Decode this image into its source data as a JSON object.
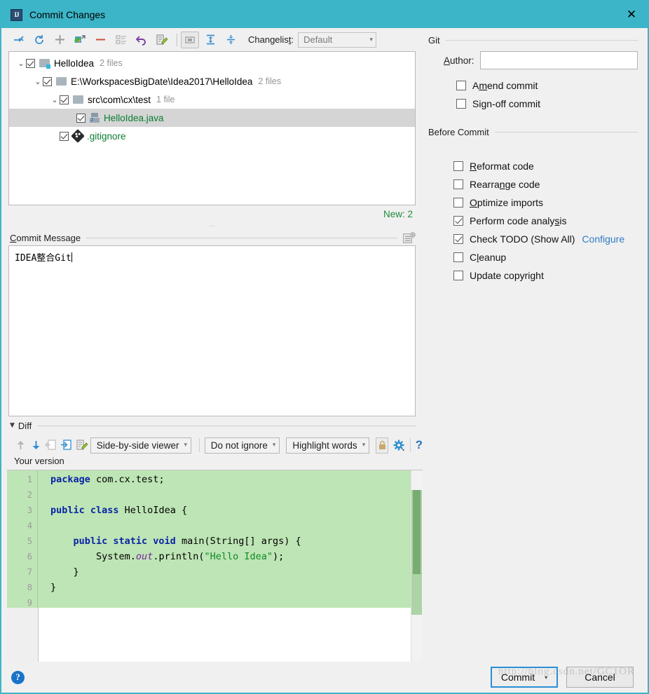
{
  "window": {
    "title": "Commit Changes",
    "app_icon_text": "IJ",
    "close_label": "✕"
  },
  "toolbar": {
    "icons": [
      {
        "name": "move-to-another-changelist-icon",
        "glyph": "→"
      },
      {
        "name": "refresh-icon",
        "glyph": "↻"
      },
      {
        "name": "add-icon",
        "glyph": "+"
      },
      {
        "name": "show-diff-icon",
        "glyph": "◰"
      },
      {
        "name": "delete-icon",
        "glyph": "−"
      },
      {
        "name": "group-by-icon",
        "glyph": "≣"
      },
      {
        "name": "revert-icon",
        "glyph": "↩"
      },
      {
        "name": "edit-source-icon",
        "glyph": "✎"
      },
      {
        "name": "group-by-directory-icon",
        "glyph": "▭"
      },
      {
        "name": "expand-all-icon",
        "glyph": "⤓"
      },
      {
        "name": "collapse-all-icon",
        "glyph": "⤒"
      }
    ],
    "changelist_label": "Changelist:",
    "changelist_value": "Default"
  },
  "tree": {
    "rows": [
      {
        "indent": 0,
        "twisty": "⌄",
        "checked": true,
        "icon": "folder-accent",
        "name": "HelloIdea",
        "count": "2 files",
        "green": false,
        "selected": false
      },
      {
        "indent": 1,
        "twisty": "⌄",
        "checked": true,
        "icon": "folder",
        "name": "E:\\WorkspacesBigDate\\Idea2017\\HelloIdea",
        "count": "2 files",
        "green": false,
        "selected": false
      },
      {
        "indent": 2,
        "twisty": "⌄",
        "checked": true,
        "icon": "folder",
        "name": "src\\com\\cx\\test",
        "count": "1 file",
        "green": false,
        "selected": false
      },
      {
        "indent": 3,
        "twisty": "",
        "checked": true,
        "icon": "java",
        "name": "HelloIdea.java",
        "count": "",
        "green": true,
        "selected": true
      },
      {
        "indent": 2,
        "twisty": "",
        "checked": true,
        "icon": "git",
        "name": ".gitignore",
        "count": "",
        "green": true,
        "selected": false
      }
    ],
    "new_count": "New: 2"
  },
  "commit_message": {
    "label_prefix": "C",
    "label": "ommit Message",
    "icon_name": "commit-message-history-icon",
    "value": "IDEA整合Git"
  },
  "git_panel": {
    "group_title": "Git",
    "author_label_prefix": "A",
    "author_label": "uthor:",
    "author_value": "",
    "checkboxes": [
      {
        "name": "amend-commit",
        "label_pre": "A",
        "label_under": "m",
        "label_post": "end commit",
        "checked": false
      },
      {
        "name": "sign-off-commit",
        "label_pre": "Si",
        "label_under": "g",
        "label_post": "n-off commit",
        "checked": false
      }
    ]
  },
  "before_commit": {
    "group_title": "Before Commit",
    "checkboxes": [
      {
        "name": "reformat-code",
        "label_pre": "",
        "label_under": "R",
        "label_post": "eformat code",
        "checked": false,
        "link": ""
      },
      {
        "name": "rearrange-code",
        "label_pre": "Rearra",
        "label_under": "n",
        "label_post": "ge code",
        "checked": false,
        "link": ""
      },
      {
        "name": "optimize-imports",
        "label_pre": "",
        "label_under": "O",
        "label_post": "ptimize imports",
        "checked": false,
        "link": ""
      },
      {
        "name": "perform-code-analysis",
        "label_pre": "Perform code analy",
        "label_under": "s",
        "label_post": "is",
        "checked": true,
        "link": ""
      },
      {
        "name": "check-todo",
        "label_pre": "Check TODO (Show All)",
        "label_under": "",
        "label_post": "",
        "checked": true,
        "link": "Configure"
      },
      {
        "name": "cleanup",
        "label_pre": "C",
        "label_under": "l",
        "label_post": "eanup",
        "checked": false,
        "link": ""
      },
      {
        "name": "update-copyright",
        "label_pre": "Update copyright",
        "label_under": "",
        "label_post": "",
        "checked": false,
        "link": ""
      }
    ]
  },
  "diff": {
    "section_title": "Diff",
    "collapse_glyph": "▼",
    "toolbar_icons": [
      {
        "name": "previous-difference-icon",
        "glyph": "↑"
      },
      {
        "name": "next-difference-icon",
        "glyph": "↓"
      },
      {
        "name": "revert-change-icon",
        "glyph": "⇤"
      },
      {
        "name": "apply-change-icon",
        "glyph": "⇥"
      },
      {
        "name": "edit-source-icon",
        "glyph": "✎"
      }
    ],
    "viewer_mode": "Side-by-side viewer",
    "whitespace_mode": "Do not ignore",
    "highlight_mode": "Highlight words",
    "lock_icon": "lock-icon",
    "settings_icon": "gear-icon",
    "help_glyph": "?",
    "pane_title": "Your version",
    "ok_check_glyph": "✔",
    "code": [
      {
        "n": "1",
        "fold": false,
        "tokens": [
          {
            "t": "package",
            "c": "kw"
          },
          {
            "t": " com.cx.test;",
            "c": "plain"
          }
        ]
      },
      {
        "n": "2",
        "fold": false,
        "tokens": []
      },
      {
        "n": "3",
        "fold": true,
        "tokens": [
          {
            "t": "public class",
            "c": "kw"
          },
          {
            "t": " HelloIdea {",
            "c": "plain"
          }
        ]
      },
      {
        "n": "4",
        "fold": false,
        "tokens": []
      },
      {
        "n": "5",
        "fold": true,
        "tokens": [
          {
            "t": "    ",
            "c": "plain"
          },
          {
            "t": "public static void",
            "c": "kw"
          },
          {
            "t": " main(String[] args) {",
            "c": "plain"
          }
        ]
      },
      {
        "n": "6",
        "fold": false,
        "tokens": [
          {
            "t": "        System.",
            "c": "plain"
          },
          {
            "t": "out",
            "c": "field"
          },
          {
            "t": ".println(",
            "c": "plain"
          },
          {
            "t": "\"Hello Idea\"",
            "c": "str"
          },
          {
            "t": ");",
            "c": "plain"
          }
        ]
      },
      {
        "n": "7",
        "fold": false,
        "tokens": [
          {
            "t": "    }",
            "c": "plain"
          }
        ]
      },
      {
        "n": "8",
        "fold": false,
        "tokens": [
          {
            "t": "}",
            "c": "plain"
          }
        ]
      },
      {
        "n": "9",
        "fold": false,
        "tokens": []
      }
    ]
  },
  "footer": {
    "help_glyph": "?",
    "commit_label": "Commit",
    "commit_caret": "▾",
    "cancel_label": "Cancel",
    "watermark": "http://blog.csdn.net/GC1OR"
  }
}
